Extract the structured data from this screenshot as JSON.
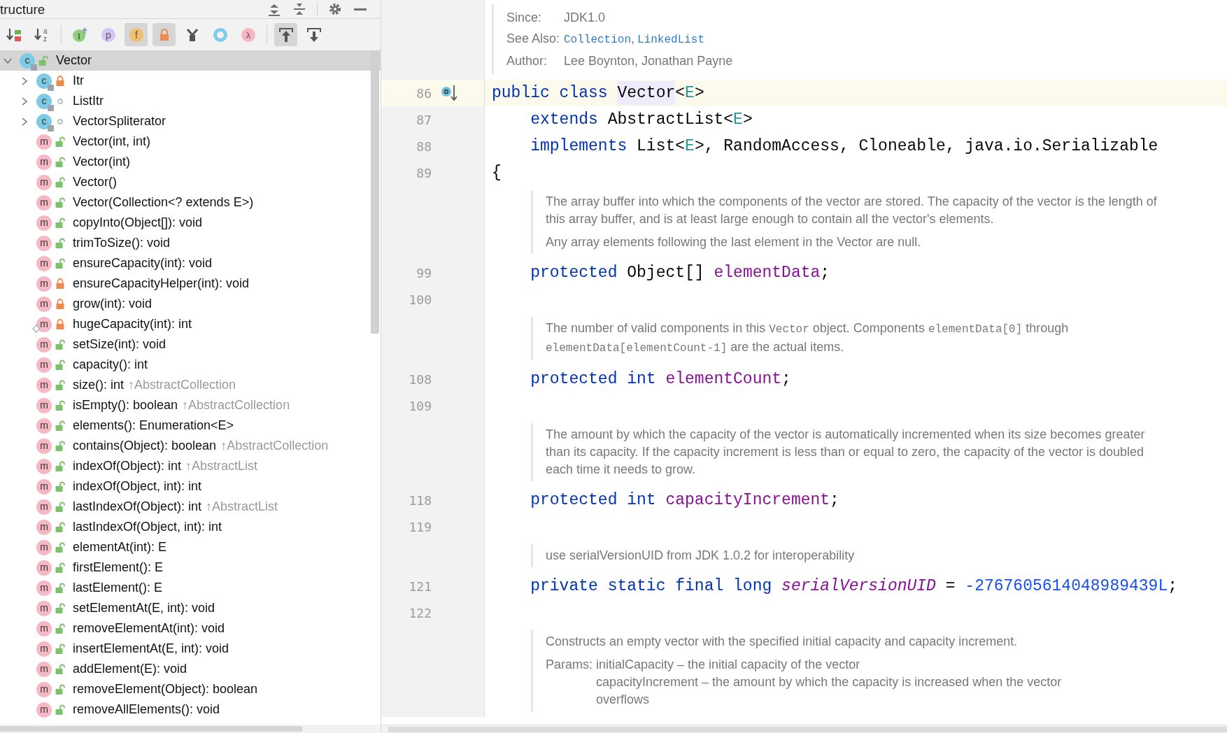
{
  "structure": {
    "title": "tructure",
    "header_buttons": [
      {
        "kind": "expand-all"
      },
      {
        "kind": "collapse-all"
      },
      {
        "kind": "separator"
      },
      {
        "kind": "settings"
      },
      {
        "kind": "minimize"
      }
    ],
    "toolbar": [
      {
        "kind": "sort-visibility",
        "selected": false
      },
      {
        "kind": "sort-alpha",
        "selected": false,
        "glyphs": [
          "a",
          "z"
        ]
      },
      {
        "kind": "separator"
      },
      {
        "kind": "inherited",
        "selected": false,
        "glyph": "I"
      },
      {
        "kind": "properties",
        "selected": false,
        "glyph": "p"
      },
      {
        "kind": "fields",
        "selected": true,
        "glyph": "f"
      },
      {
        "kind": "non-public",
        "selected": true
      },
      {
        "kind": "fork",
        "selected": false
      },
      {
        "kind": "anonymous",
        "selected": false
      },
      {
        "kind": "lambdas",
        "selected": false,
        "glyph": "λ"
      },
      {
        "kind": "separator"
      },
      {
        "kind": "scroll-to-source",
        "selected": true
      },
      {
        "kind": "scroll-from-source",
        "selected": false
      }
    ],
    "tree": [
      {
        "kind": "class",
        "icon_letter": "c",
        "locked": false,
        "package_private": false,
        "name": "Vector",
        "selected": true,
        "expanded": true,
        "children": [
          {
            "kind": "class",
            "icon_letter": "c",
            "locked": true,
            "package_private": false,
            "name": "Itr",
            "selected": false,
            "expanded": false
          },
          {
            "kind": "class",
            "icon_letter": "c",
            "locked": false,
            "package_private": true,
            "name": "ListItr",
            "selected": false,
            "expanded": false
          },
          {
            "kind": "class",
            "icon_letter": "c",
            "locked": false,
            "package_private": true,
            "name": "VectorSpliterator",
            "selected": false,
            "expanded": false
          },
          {
            "kind": "method",
            "icon_letter": "m",
            "locked": false,
            "package_private": false,
            "name": "Vector(int, int)",
            "selected": false
          },
          {
            "kind": "method",
            "icon_letter": "m",
            "locked": false,
            "package_private": false,
            "name": "Vector(int)",
            "selected": false
          },
          {
            "kind": "method",
            "icon_letter": "m",
            "locked": false,
            "package_private": false,
            "name": "Vector()",
            "selected": false
          },
          {
            "kind": "method",
            "icon_letter": "m",
            "locked": false,
            "package_private": false,
            "name": "Vector(Collection<? extends E>)",
            "selected": false
          },
          {
            "kind": "method",
            "icon_letter": "m",
            "locked": false,
            "package_private": false,
            "name": "copyInto(Object[]): void",
            "selected": false
          },
          {
            "kind": "method",
            "icon_letter": "m",
            "locked": false,
            "package_private": false,
            "name": "trimToSize(): void",
            "selected": false
          },
          {
            "kind": "method",
            "icon_letter": "m",
            "locked": false,
            "package_private": false,
            "name": "ensureCapacity(int): void",
            "selected": false
          },
          {
            "kind": "method",
            "icon_letter": "m",
            "locked": true,
            "package_private": false,
            "name": "ensureCapacityHelper(int): void",
            "selected": false
          },
          {
            "kind": "method",
            "icon_letter": "m",
            "locked": true,
            "package_private": false,
            "name": "grow(int): void",
            "selected": false
          },
          {
            "kind": "method",
            "icon_letter": "m",
            "locked": true,
            "package_private": false,
            "name": "hugeCapacity(int): int",
            "selected": false,
            "static": true
          },
          {
            "kind": "method",
            "icon_letter": "m",
            "locked": false,
            "package_private": false,
            "name": "setSize(int): void",
            "selected": false
          },
          {
            "kind": "method",
            "icon_letter": "m",
            "locked": false,
            "package_private": false,
            "name": "capacity(): int",
            "selected": false
          },
          {
            "kind": "method",
            "icon_letter": "m",
            "locked": false,
            "package_private": false,
            "name": "size(): int",
            "inherited": "↑AbstractCollection",
            "selected": false
          },
          {
            "kind": "method",
            "icon_letter": "m",
            "locked": false,
            "package_private": false,
            "name": "isEmpty(): boolean",
            "inherited": "↑AbstractCollection",
            "selected": false
          },
          {
            "kind": "method",
            "icon_letter": "m",
            "locked": false,
            "package_private": false,
            "name": "elements(): Enumeration<E>",
            "selected": false
          },
          {
            "kind": "method",
            "icon_letter": "m",
            "locked": false,
            "package_private": false,
            "name": "contains(Object): boolean",
            "inherited": "↑AbstractCollection",
            "selected": false
          },
          {
            "kind": "method",
            "icon_letter": "m",
            "locked": false,
            "package_private": false,
            "name": "indexOf(Object): int",
            "inherited": "↑AbstractList",
            "selected": false
          },
          {
            "kind": "method",
            "icon_letter": "m",
            "locked": false,
            "package_private": false,
            "name": "indexOf(Object, int): int",
            "selected": false
          },
          {
            "kind": "method",
            "icon_letter": "m",
            "locked": false,
            "package_private": false,
            "name": "lastIndexOf(Object): int",
            "inherited": "↑AbstractList",
            "selected": false
          },
          {
            "kind": "method",
            "icon_letter": "m",
            "locked": false,
            "package_private": false,
            "name": "lastIndexOf(Object, int): int",
            "selected": false
          },
          {
            "kind": "method",
            "icon_letter": "m",
            "locked": false,
            "package_private": false,
            "name": "elementAt(int): E",
            "selected": false
          },
          {
            "kind": "method",
            "icon_letter": "m",
            "locked": false,
            "package_private": false,
            "name": "firstElement(): E",
            "selected": false
          },
          {
            "kind": "method",
            "icon_letter": "m",
            "locked": false,
            "package_private": false,
            "name": "lastElement(): E",
            "selected": false
          },
          {
            "kind": "method",
            "icon_letter": "m",
            "locked": false,
            "package_private": false,
            "name": "setElementAt(E, int): void",
            "selected": false
          },
          {
            "kind": "method",
            "icon_letter": "m",
            "locked": false,
            "package_private": false,
            "name": "removeElementAt(int): void",
            "selected": false
          },
          {
            "kind": "method",
            "icon_letter": "m",
            "locked": false,
            "package_private": false,
            "name": "insertElementAt(E, int): void",
            "selected": false
          },
          {
            "kind": "method",
            "icon_letter": "m",
            "locked": false,
            "package_private": false,
            "name": "addElement(E): void",
            "selected": false
          },
          {
            "kind": "method",
            "icon_letter": "m",
            "locked": false,
            "package_private": false,
            "name": "removeElement(Object): boolean",
            "selected": false
          },
          {
            "kind": "method",
            "icon_letter": "m",
            "locked": false,
            "package_private": false,
            "name": "removeAllElements(): void",
            "selected": false
          }
        ]
      }
    ]
  },
  "editor": {
    "lines": [
      {
        "kind": "classdoc",
        "tags": [
          {
            "label": "Since:",
            "value": "JDK1.0"
          },
          {
            "label": "See Also:",
            "links": [
              "Collection",
              "LinkedList"
            ],
            "separator": ","
          },
          {
            "label": "Author:",
            "value": "Lee Boynton, Jonathan Payne"
          }
        ]
      },
      {
        "kind": "code",
        "number": "86",
        "current": true,
        "implemented_marker": true,
        "tokens": [
          {
            "t": "public class ",
            "kind": "kw"
          },
          {
            "t": "Vector",
            "kind": "hl"
          },
          {
            "t": "<",
            "kind": "plain"
          },
          {
            "t": "E",
            "kind": "tp"
          },
          {
            "t": ">",
            "kind": "plain"
          }
        ]
      },
      {
        "kind": "code",
        "number": "87",
        "current": false,
        "tokens": [
          {
            "t": "    extends ",
            "kind": "kw"
          },
          {
            "t": "AbstractList<",
            "kind": "plain"
          },
          {
            "t": "E",
            "kind": "tp"
          },
          {
            "t": ">",
            "kind": "plain"
          }
        ]
      },
      {
        "kind": "code",
        "number": "88",
        "current": false,
        "tokens": [
          {
            "t": "    implements ",
            "kind": "kw"
          },
          {
            "t": "List<",
            "kind": "plain"
          },
          {
            "t": "E",
            "kind": "tp"
          },
          {
            "t": ">, RandomAccess, Cloneable, java.io.Serializable",
            "kind": "plain"
          }
        ]
      },
      {
        "kind": "code",
        "number": "89",
        "current": false,
        "tokens": [
          {
            "t": "{",
            "kind": "plain"
          }
        ]
      },
      {
        "kind": "memberdoc",
        "paragraphs": [
          [
            {
              "t": "The array buffer into which the components of the vector are stored. The capacity of the vector is the length of this array buffer, and is at least large enough to contain all the vector's elements.",
              "code": false
            }
          ],
          [
            {
              "t": "Any array elements following the last element in the Vector are null.",
              "code": false
            }
          ]
        ]
      },
      {
        "kind": "code",
        "number": "99",
        "current": false,
        "tokens": [
          {
            "t": "    protected ",
            "kind": "kw"
          },
          {
            "t": "Object[] ",
            "kind": "plain"
          },
          {
            "t": "elementData",
            "kind": "field"
          },
          {
            "t": ";",
            "kind": "plain"
          }
        ]
      },
      {
        "kind": "code",
        "number": "100",
        "current": false
      },
      {
        "kind": "memberdoc",
        "paragraphs": [
          [
            {
              "t": "The number of valid components in this ",
              "code": false
            },
            {
              "t": "Vector",
              "code": true
            },
            {
              "t": " object. Components ",
              "code": false
            },
            {
              "t": "elementData[0]",
              "code": true
            },
            {
              "t": " through ",
              "code": false
            },
            {
              "t": "elementData[elementCount-1]",
              "code": true
            },
            {
              "t": " are the actual items.",
              "code": false
            }
          ]
        ]
      },
      {
        "kind": "code",
        "number": "108",
        "current": false,
        "tokens": [
          {
            "t": "    protected int ",
            "kind": "kw"
          },
          {
            "t": "elementCount",
            "kind": "field"
          },
          {
            "t": ";",
            "kind": "plain"
          }
        ]
      },
      {
        "kind": "code",
        "number": "109",
        "current": false
      },
      {
        "kind": "memberdoc",
        "paragraphs": [
          [
            {
              "t": "The amount by which the capacity of the vector is automatically incremented when its size becomes greater than its capacity. If the capacity increment is less than or equal to zero, the capacity of the vector is doubled each time it needs to grow.",
              "code": false
            }
          ]
        ]
      },
      {
        "kind": "code",
        "number": "118",
        "current": false,
        "tokens": [
          {
            "t": "    protected int ",
            "kind": "kw"
          },
          {
            "t": "capacityIncrement",
            "kind": "field"
          },
          {
            "t": ";",
            "kind": "plain"
          }
        ]
      },
      {
        "kind": "code",
        "number": "119",
        "current": false
      },
      {
        "kind": "memberdoc",
        "paragraphs": [
          [
            {
              "t": "use serialVersionUID from JDK 1.0.2 for interoperability",
              "code": false
            }
          ]
        ]
      },
      {
        "kind": "code",
        "number": "121",
        "current": false,
        "tokens": [
          {
            "t": "    private static final long ",
            "kind": "kw"
          },
          {
            "t": "serialVersionUID",
            "kind": "static"
          },
          {
            "t": " = ",
            "kind": "plain"
          },
          {
            "t": "-2767605614048989439L",
            "kind": "num"
          },
          {
            "t": ";",
            "kind": "plain"
          }
        ]
      },
      {
        "kind": "code",
        "number": "122",
        "current": false
      },
      {
        "kind": "memberdoc",
        "paragraphs": [
          [
            {
              "t": "Constructs an empty vector with the specified initial capacity and capacity increment.",
              "code": false
            }
          ]
        ],
        "params": {
          "label": "Params:",
          "values": [
            "initialCapacity – the initial capacity of the vector",
            "capacityIncrement – the amount by which the capacity is increased when the vector overflows"
          ]
        }
      }
    ]
  }
}
